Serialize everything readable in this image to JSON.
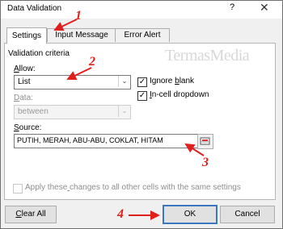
{
  "window": {
    "title": "Data Validation",
    "help_glyph": "?",
    "close_glyph": "✕"
  },
  "tabs": [
    {
      "label": "Settings",
      "active": true
    },
    {
      "label": "Input Message",
      "active": false
    },
    {
      "label": "Error Alert",
      "active": false
    }
  ],
  "settings": {
    "section_title": "Validation criteria",
    "allow_label": "Allow:",
    "allow_value": "List",
    "data_label": "Data:",
    "data_value": "between",
    "ignore_blank_label": "Ignore blank",
    "ignore_blank_checked": true,
    "incell_dropdown_label": "In-cell dropdown",
    "incell_dropdown_checked": true,
    "source_label": "Source:",
    "source_value": "PUTIH, MERAH, ABU-ABU, COKLAT, HITAM",
    "apply_all_label": "Apply these changes to all other cells with the same settings",
    "apply_all_checked": false
  },
  "buttons": {
    "clear_all": "Clear All",
    "ok": "OK",
    "cancel": "Cancel"
  },
  "annotations": {
    "n1": "1",
    "n2": "2",
    "n3": "3",
    "n4": "4"
  },
  "watermark": "TermasMedia",
  "colors": {
    "annotation_red": "#e0201c",
    "ok_border": "#3b76c1"
  }
}
